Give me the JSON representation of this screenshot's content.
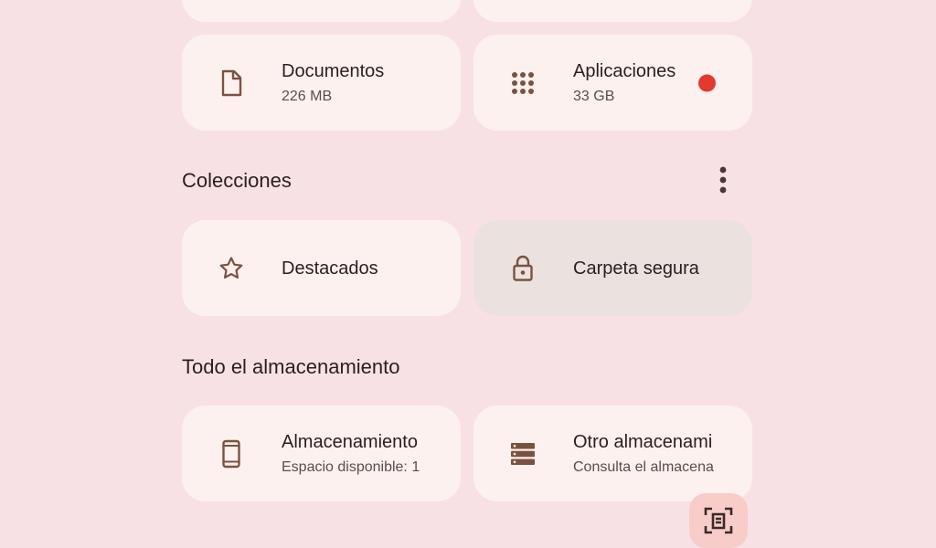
{
  "colors": {
    "background": "#f8e1e4",
    "card": "#fdf1ef",
    "card_active": "#ebe2e0",
    "icon": "#7a5340",
    "badge": "#e3392f",
    "fab": "#f7ccc9"
  },
  "categories": [
    {
      "title": "Documentos",
      "subtitle": "226 MB",
      "icon": "document-icon"
    },
    {
      "title": "Aplicaciones",
      "subtitle": "33 GB",
      "icon": "apps-grid-icon",
      "badge": true
    }
  ],
  "collections": {
    "heading": "Colecciones",
    "menu_icon": "more-vert-icon",
    "items": [
      {
        "title": "Destacados",
        "icon": "star-icon"
      },
      {
        "title": "Carpeta segura",
        "icon": "lock-icon"
      }
    ]
  },
  "storage": {
    "heading": "Todo el almacenamiento",
    "items": [
      {
        "title": "Almacenamiento",
        "subtitle": "Espacio disponible: 1",
        "icon": "phone-icon"
      },
      {
        "title": "Otro almacenami",
        "subtitle": "Consulta el almacena",
        "icon": "storage-icon"
      }
    ]
  },
  "fab": {
    "icon": "scan-document-icon"
  }
}
